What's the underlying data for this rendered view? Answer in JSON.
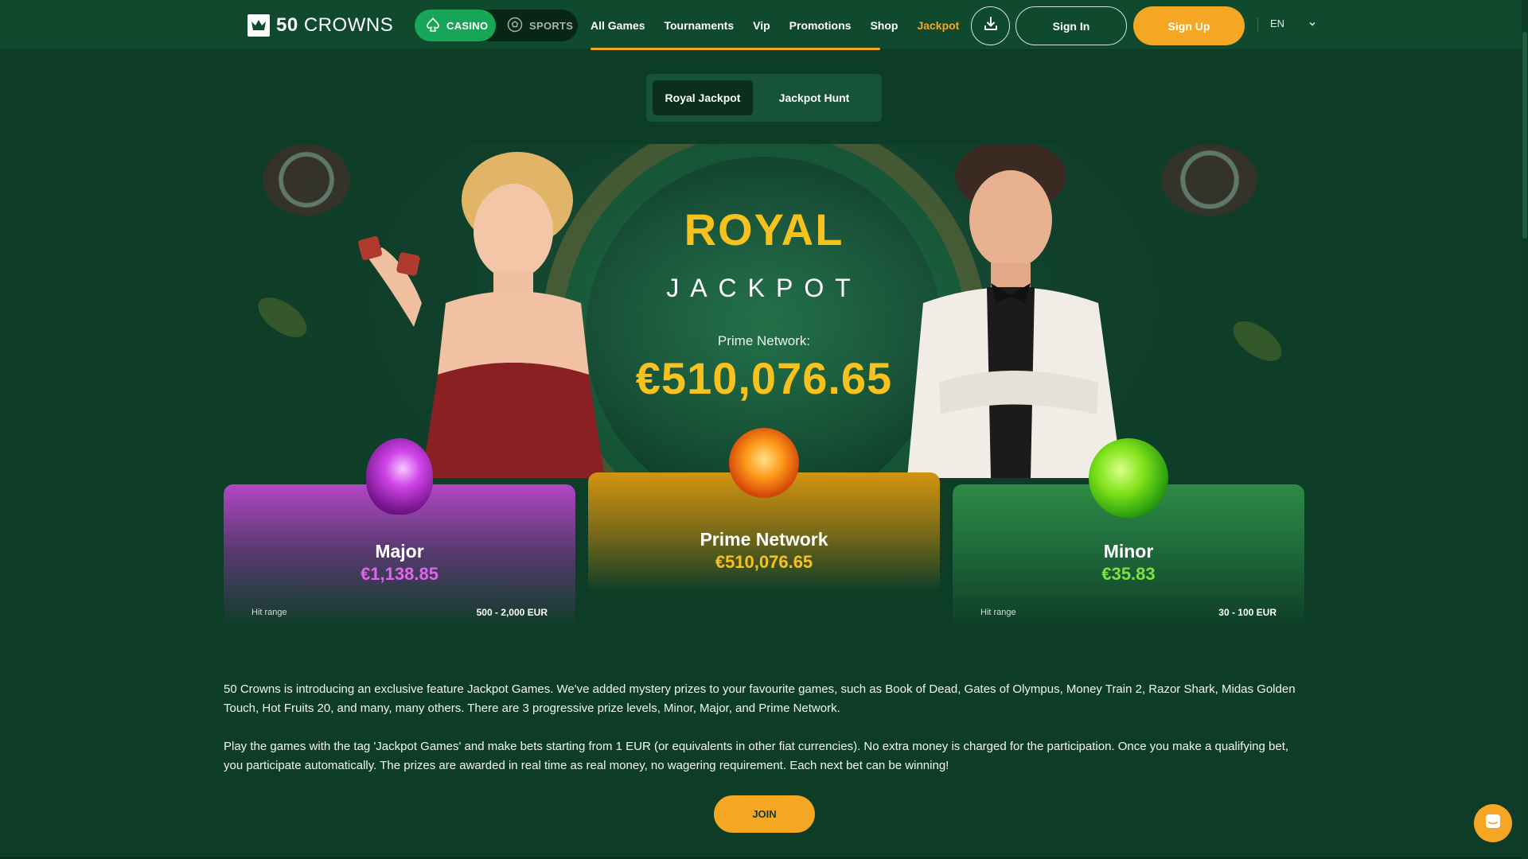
{
  "header": {
    "logo_text_bold": "50",
    "logo_text": "CROWNS",
    "mode_casino": "CASINO",
    "mode_sports": "SPORTS",
    "nav": [
      "All Games",
      "Tournaments",
      "Vip",
      "Promotions",
      "Shop",
      "Jackpot"
    ],
    "active_nav": "Jackpot",
    "signin": "Sign In",
    "signup": "Sign Up",
    "language": "EN"
  },
  "tabs": {
    "royal": "Royal Jackpot",
    "hunt": "Jackpot Hunt"
  },
  "hero": {
    "title": "ROYAL",
    "subtitle": "JACKPOT",
    "label": "Prime Network:",
    "amount": "€510,076.65"
  },
  "cards": {
    "major": {
      "name": "Major",
      "value": "€1,138.85",
      "range_label": "Hit range",
      "range": "500 - 2,000 EUR"
    },
    "prime": {
      "name": "Prime Network",
      "value": "€510,076.65"
    },
    "minor": {
      "name": "Minor",
      "value": "€35.83",
      "range_label": "Hit range",
      "range": "30 - 100 EUR"
    }
  },
  "description": {
    "p1": "50 Crowns is introducing an exclusive feature Jackpot Games. We've added mystery prizes to your favourite games, such as Book of Dead, Gates of Olympus, Money Train 2, Razor Shark, Midas Golden Touch, Hot Fruits 20, and many, many others. There are 3 progressive prize levels, Minor, Major, and Prime Network.",
    "p2": "Play the games with the tag 'Jackpot Games' and make bets starting from 1 EUR (or equivalents in other fiat currencies). No extra money is charged for the participation. Once you make a qualifying bet, you participate automatically. The prizes are awarded in real time as real money, no wagering requirement. Each next bet can be winning!"
  },
  "join": "JOIN",
  "colors": {
    "background": "#0e3d27",
    "accent": "#f5a623",
    "gold": "#f7c21e",
    "casino_green": "#17a558",
    "major_purple": "#e163f0",
    "minor_green": "#7de23f"
  }
}
